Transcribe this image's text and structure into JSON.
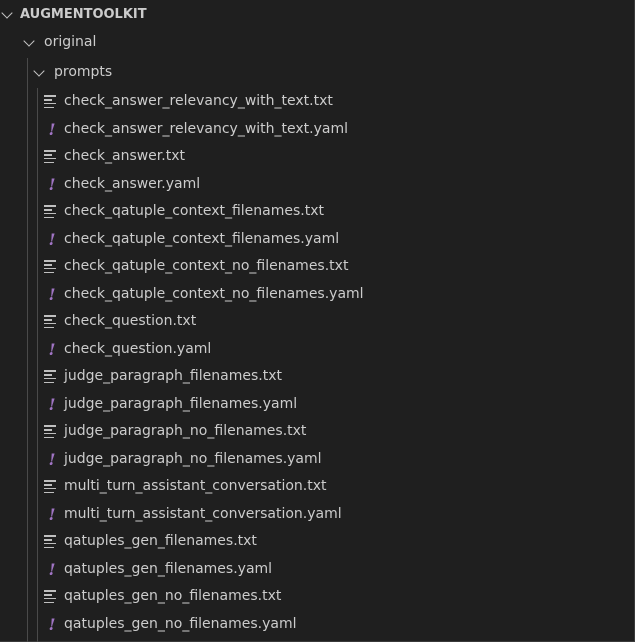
{
  "explorer": {
    "root": {
      "label": "AUGMENTOOLKIT"
    },
    "folders": [
      {
        "label": "original"
      },
      {
        "label": "prompts"
      }
    ],
    "files": [
      {
        "name": "check_answer_relevancy_with_text.txt",
        "icon": "text-file-icon"
      },
      {
        "name": "check_answer_relevancy_with_text.yaml",
        "icon": "yaml-file-icon"
      },
      {
        "name": "check_answer.txt",
        "icon": "text-file-icon"
      },
      {
        "name": "check_answer.yaml",
        "icon": "yaml-file-icon"
      },
      {
        "name": "check_qatuple_context_filenames.txt",
        "icon": "text-file-icon"
      },
      {
        "name": "check_qatuple_context_filenames.yaml",
        "icon": "yaml-file-icon"
      },
      {
        "name": "check_qatuple_context_no_filenames.txt",
        "icon": "text-file-icon"
      },
      {
        "name": "check_qatuple_context_no_filenames.yaml",
        "icon": "yaml-file-icon"
      },
      {
        "name": "check_question.txt",
        "icon": "text-file-icon"
      },
      {
        "name": "check_question.yaml",
        "icon": "yaml-file-icon"
      },
      {
        "name": "judge_paragraph_filenames.txt",
        "icon": "text-file-icon"
      },
      {
        "name": "judge_paragraph_filenames.yaml",
        "icon": "yaml-file-icon"
      },
      {
        "name": "judge_paragraph_no_filenames.txt",
        "icon": "text-file-icon"
      },
      {
        "name": "judge_paragraph_no_filenames.yaml",
        "icon": "yaml-file-icon"
      },
      {
        "name": "multi_turn_assistant_conversation.txt",
        "icon": "text-file-icon"
      },
      {
        "name": "multi_turn_assistant_conversation.yaml",
        "icon": "yaml-file-icon"
      },
      {
        "name": "qatuples_gen_filenames.txt",
        "icon": "text-file-icon"
      },
      {
        "name": "qatuples_gen_filenames.yaml",
        "icon": "yaml-file-icon"
      },
      {
        "name": "qatuples_gen_no_filenames.txt",
        "icon": "text-file-icon"
      },
      {
        "name": "qatuples_gen_no_filenames.yaml",
        "icon": "yaml-file-icon"
      }
    ],
    "colors": {
      "background": "#1f1f1f",
      "text": "#cccccc",
      "yaml_icon": "#a074c4",
      "txt_icon": "#bfbfbf"
    }
  }
}
